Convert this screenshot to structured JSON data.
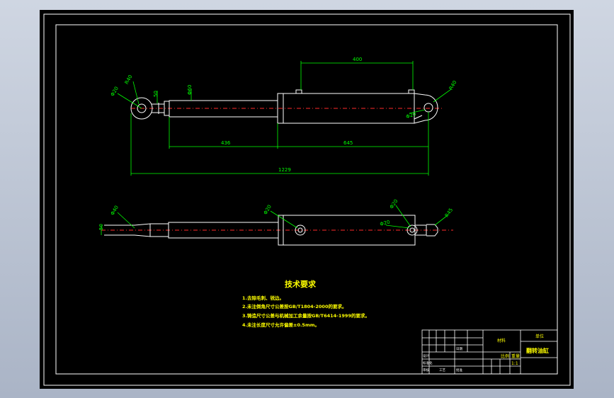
{
  "drawing": {
    "dimensions": {
      "top_view_span": "400",
      "rod_length": "436",
      "cylinder_length": "645",
      "overall_length": "1229",
      "eye_dia_left": "R40",
      "pin_dia_left": "Φ20",
      "rod_dia": "50",
      "rod_dia2": "Φ60",
      "ear_dia_right": "R40",
      "ear_hole_right": "Φ20",
      "lower_left_dia": "Φ40",
      "lower_left_height": "50",
      "lower_port1": "Φ20",
      "lower_port2": "Φ20",
      "lower_port3": "Φ20",
      "lower_right_dia": "R45"
    },
    "requirements": {
      "title": "技术要求",
      "items": [
        "1.去除毛刺、锐边。",
        "2.未注倒角尺寸公差按GB/T1804-2000的要求。",
        "3.铸造尺寸公差与机械加工余量按GB/T6414-1999的要求。",
        "4.未注长度尺寸允许偏差±0.5mm。"
      ]
    },
    "title_block": {
      "part_name": "翻转油缸",
      "material_label": "材料",
      "company_label": "单位",
      "scale_label": "比例",
      "weight_label": "重量",
      "scale_value": "1:1",
      "designer_label": "设计",
      "review_label": "审核",
      "process_label": "工艺",
      "approve_label": "批准",
      "standard_label": "标准化",
      "date_label": "日期"
    }
  }
}
